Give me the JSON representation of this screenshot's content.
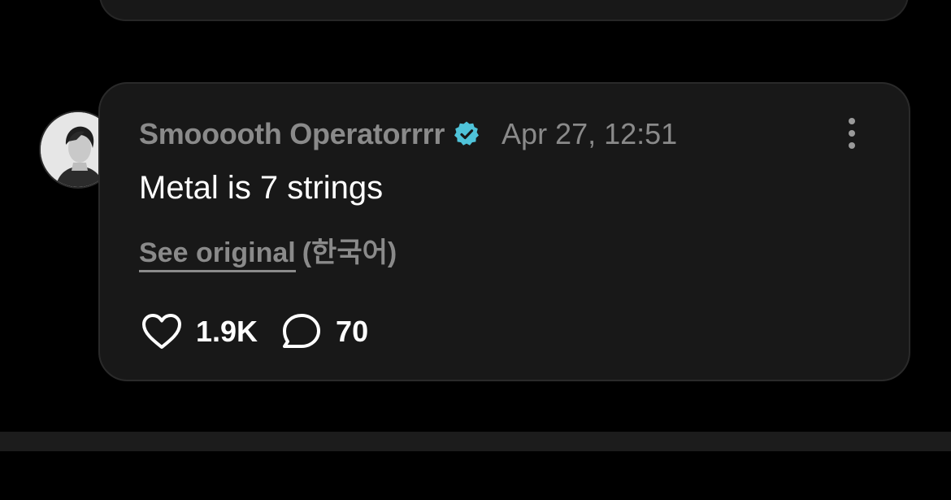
{
  "post": {
    "username": "Smooooth Operatorrrr",
    "verified": true,
    "timestamp": "Apr 27, 12:51",
    "text": "Metal is 7 strings",
    "see_original_label": "See original",
    "language": "(한국어)",
    "likes": "1.9K",
    "comments": "70"
  },
  "icons": {
    "verified": "verified-badge-icon",
    "more": "more-vertical-icon",
    "like": "heart-icon",
    "comment": "comment-bubble-icon"
  },
  "colors": {
    "background": "#000000",
    "card": "#181818",
    "muted_text": "#8a8a8a",
    "primary_text": "#ffffff",
    "verified_badge": "#4fc3d9"
  }
}
